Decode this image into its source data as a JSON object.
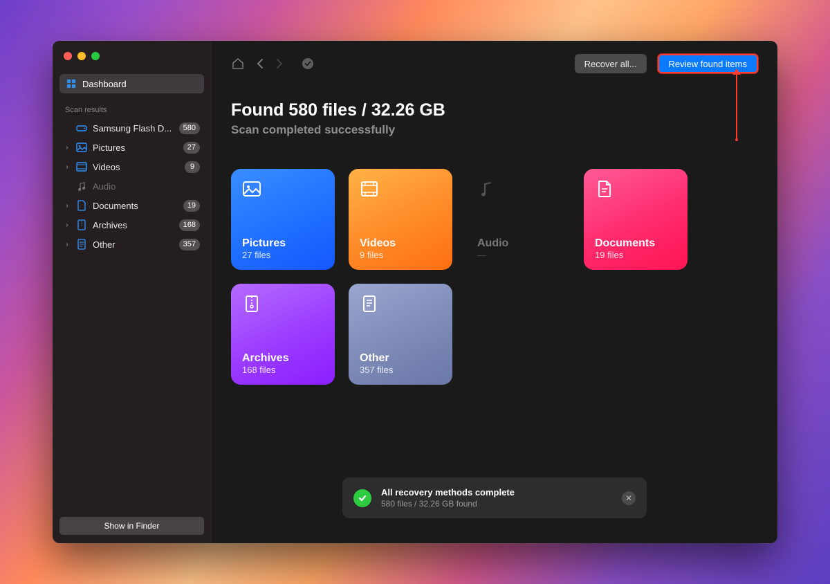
{
  "sidebar": {
    "dashboard_label": "Dashboard",
    "section_label": "Scan results",
    "items": [
      {
        "label": "Samsung Flash D...",
        "count": "580"
      },
      {
        "label": "Pictures",
        "count": "27"
      },
      {
        "label": "Videos",
        "count": "9"
      },
      {
        "label": "Audio",
        "count": null
      },
      {
        "label": "Documents",
        "count": "19"
      },
      {
        "label": "Archives",
        "count": "168"
      },
      {
        "label": "Other",
        "count": "357"
      }
    ],
    "footer_button": "Show in Finder"
  },
  "toolbar": {
    "recover_all_label": "Recover all...",
    "review_label": "Review found items"
  },
  "header": {
    "title": "Found 580 files / 32.26 GB",
    "subtitle": "Scan completed successfully"
  },
  "cards": {
    "pictures": {
      "name": "Pictures",
      "count": "27 files"
    },
    "videos": {
      "name": "Videos",
      "count": "9 files"
    },
    "audio": {
      "name": "Audio",
      "count": "—"
    },
    "documents": {
      "name": "Documents",
      "count": "19 files"
    },
    "archives": {
      "name": "Archives",
      "count": "168 files"
    },
    "other": {
      "name": "Other",
      "count": "357 files"
    }
  },
  "toast": {
    "title": "All recovery methods complete",
    "subtitle": "580 files / 32.26 GB found"
  },
  "colors": {
    "accent": "#0a7aff",
    "highlight_border": "#ff3a2f"
  }
}
